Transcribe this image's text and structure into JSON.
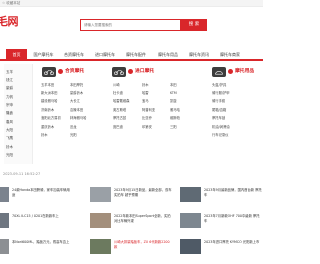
{
  "topbar": {
    "favorite": "☆ 收藏本站"
  },
  "logo": {
    "text": "毛网"
  },
  "search": {
    "placeholder": "请输入您要搜索的",
    "button": "搜 索"
  },
  "nav": [
    {
      "label": "首页",
      "active": true
    },
    {
      "label": "国产摩托车",
      "active": false
    },
    {
      "label": "合资摩托车",
      "active": false
    },
    {
      "label": "进口摩托车",
      "active": false
    },
    {
      "label": "摩托车配件",
      "active": false
    },
    {
      "label": "摩托车用品",
      "active": false
    },
    {
      "label": "摩托车资讯",
      "active": false
    },
    {
      "label": "摩托车商家",
      "active": false
    }
  ],
  "sidebar": {
    "items": [
      "五羊",
      "钱江",
      "豪爵",
      "力帆",
      "宗申",
      "隆鑫",
      "春风",
      "大阳",
      "飞鹰",
      "铃木",
      "光阳"
    ]
  },
  "panels": [
    {
      "title": "合资摩托",
      "cells": [
        [
          "五羊本田",
          "本田摩托"
        ],
        [
          "新大洲本田",
          "豪爵铃木"
        ],
        [
          "建设雅马哈",
          "大长江"
        ],
        [
          "济南铃木",
          "嘉陵本田"
        ],
        [
          "洛阳北方易初",
          "林海雅马哈"
        ],
        [
          "重庆铃木",
          "迅龙"
        ],
        [
          "铃木",
          "光阳"
        ]
      ]
    },
    {
      "title": "进口摩托",
      "cells": [
        [
          "川崎",
          "铃木",
          "本田"
        ],
        [
          "杜卡迪",
          "哈雷",
          "KTM"
        ],
        [
          "哈雷戴维森",
          "宝马",
          "凯旋"
        ],
        [
          "奥古斯塔",
          "阿普利亚",
          "雅马哈"
        ],
        [
          "摩托古兹",
          "比亚乔",
          "维斯帕"
        ],
        [
          "庞巴迪",
          "印第安",
          "三阳"
        ]
      ]
    },
    {
      "title": "摩托用品",
      "cells": [
        [
          "头盔/护具"
        ],
        [
          "骑行服/护甲"
        ],
        [
          "骑行手套"
        ],
        [
          "尾箱/边箱"
        ],
        [
          "摩托车锁"
        ],
        [
          "机油/润滑油"
        ],
        [
          "行车记录仪"
        ]
      ]
    }
  ],
  "date_line": "2023-09-11 16:52:27",
  "news": [
    [
      {
        "text": "24款Honda本田跨骑，家车加装车辆用途",
        "red": false
      },
      {
        "text": "2023年9月15日新品，最新全部，双车实拍车 超乎预期",
        "red": false
      },
      {
        "text": "2023年9月最新品牌，国内首台新 摩托车",
        "red": false
      }
    ],
    [
      {
        "text": "70XL ILC15 / 0201在新款车上",
        "red": false
      },
      {
        "text": "2022年款本田SuperSport全新，实拍对比车辆外观",
        "red": false
      },
      {
        "text": "2023年7月新款OHF 700中级新 摩托车",
        "red": false
      }
    ],
    [
      {
        "text": "本Nori600ML，踏板万元，闯高车边上",
        "red": false
      },
      {
        "text": "川崎大排量踏板车，ZX 6代新款2200款",
        "red": true
      },
      {
        "text": "2023年进口摩托 KYMCO 光阳新上市",
        "red": false
      }
    ]
  ]
}
